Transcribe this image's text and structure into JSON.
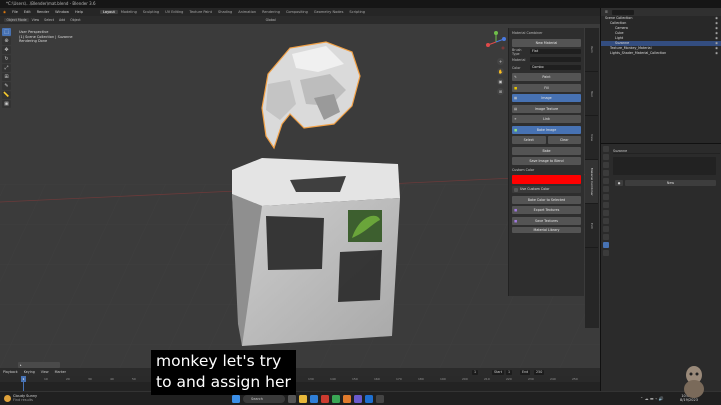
{
  "window": {
    "title": "*C:\\Users\\...\\Blender\\mat.blend - Blender 3.6"
  },
  "menubar": {
    "items": [
      "File",
      "Edit",
      "Render",
      "Window",
      "Help"
    ],
    "workspaces": [
      "Layout",
      "Modeling",
      "Sculpting",
      "UV Editing",
      "Texture Paint",
      "Shading",
      "Animation",
      "Rendering",
      "Compositing",
      "Geometry Nodes",
      "Scripting"
    ],
    "active_workspace": "Layout"
  },
  "viewport_header": {
    "mode": "Object Mode",
    "items": [
      "View",
      "Select",
      "Add",
      "Object"
    ],
    "shading": "Global"
  },
  "viewport_info": {
    "line1": "User Perspective",
    "line2": "(1) Scene Collection | Suzanne",
    "line3": "Rendering Done"
  },
  "npanel": {
    "header": "Material Combiner",
    "create_material": "New Material",
    "fields": [
      {
        "label": "Brush Type",
        "value": "Flat"
      },
      {
        "label": "Material",
        "value": ""
      },
      {
        "label": "Color",
        "value": "Combo"
      }
    ],
    "buttons": [
      "Paint",
      "Fill",
      "Image",
      "Image Texture",
      "Link",
      "Bake Image",
      "Bake",
      "Save Image to Blend",
      "Use Custom Color",
      "Bake Color to Selected",
      "Export Textures",
      "Save Textures",
      "Material Library"
    ],
    "half_buttons": [
      "Select",
      "Clear"
    ],
    "color_label": "Custom Color",
    "color": "#ff0000",
    "tabs": [
      "Item",
      "Tool",
      "View",
      "Material Combiner",
      "Edit"
    ]
  },
  "outliner": {
    "header": "Scene Collection",
    "items": [
      {
        "label": "Scene Collection",
        "indent": 0,
        "selected": false
      },
      {
        "label": "Collection",
        "indent": 1,
        "selected": false
      },
      {
        "label": "Camera",
        "indent": 2,
        "selected": false
      },
      {
        "label": "Cube",
        "indent": 2,
        "selected": false
      },
      {
        "label": "Light",
        "indent": 2,
        "selected": false
      },
      {
        "label": "Suzanne",
        "indent": 2,
        "selected": true
      },
      {
        "label": "Texture_Monkey_Material",
        "indent": 1,
        "selected": false
      },
      {
        "label": "Lights_Shader_Material_Collection",
        "indent": 1,
        "selected": false
      }
    ]
  },
  "properties": {
    "header": "Suzanne",
    "new_button": "New"
  },
  "timeline": {
    "menu": [
      "Playback",
      "Keying",
      "View",
      "Marker"
    ],
    "current_frame": "1",
    "start_label": "Start",
    "start": "1",
    "end_label": "End",
    "end": "250",
    "ticks": [
      "0",
      "10",
      "20",
      "30",
      "40",
      "50",
      "60",
      "70",
      "80",
      "90",
      "100",
      "110",
      "120",
      "130",
      "140",
      "150",
      "160",
      "170",
      "180",
      "190",
      "200",
      "210",
      "220",
      "230",
      "240",
      "250"
    ]
  },
  "taskbar": {
    "weather_temp": "Cloudy Sunny",
    "weather_desc": "Find results",
    "search_placeholder": "Search",
    "time": "10:05 AM",
    "date": "8/19/2023"
  },
  "subtitle": {
    "line1": "monkey let's try",
    "line2": "to and assign her"
  }
}
